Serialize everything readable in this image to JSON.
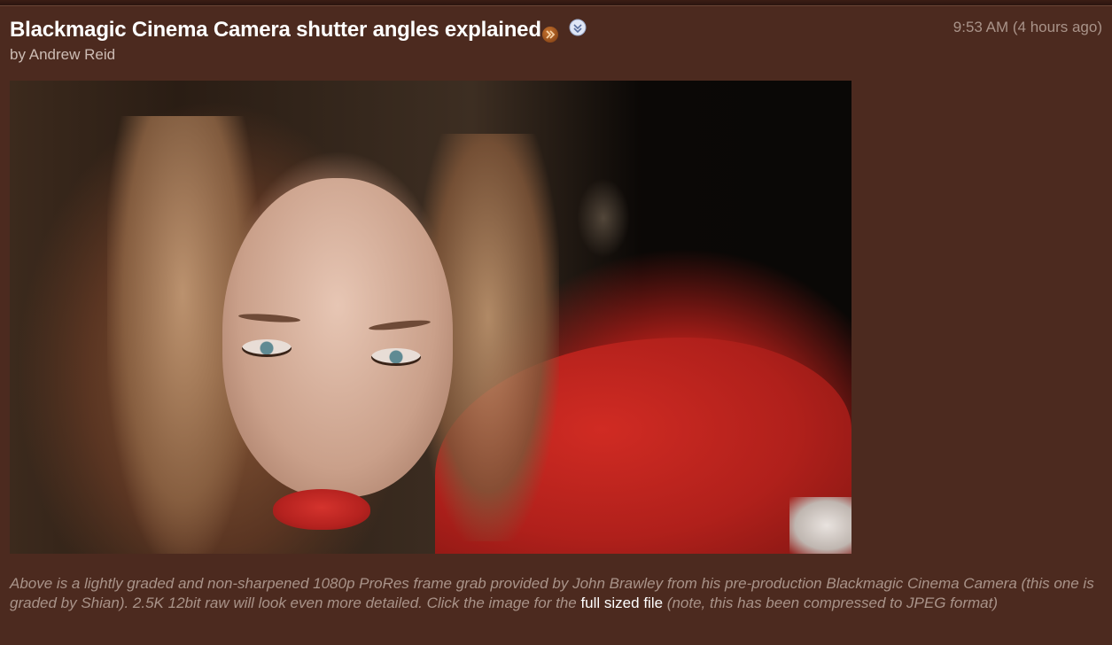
{
  "article": {
    "title": "Blackmagic Cinema Camera shutter angles explained",
    "byline": "by Andrew Reid",
    "timestamp": "9:53 AM (4 hours ago)",
    "icons": {
      "more": "double-chevron-right-icon",
      "expand": "expand-circle-icon"
    },
    "image": {
      "description_label": "portrait-frame-grab",
      "subject": "woman with blonde hair wearing red hood"
    },
    "caption": {
      "text_before_link": "Above is a lightly graded and non-sharpened 1080p ProRes frame grab provided by John Brawley from his pre-production Blackmagic Cinema Camera (this one is graded by Shian). 2.5K 12bit raw will look even more detailed. Click the image for the ",
      "link_text": "full sized file",
      "text_after_link": " (note, this has been compressed to JPEG format)"
    }
  },
  "colors": {
    "background": "#4c2a1f",
    "title": "#ffffff",
    "meta": "#a99389",
    "link": "#ffffff",
    "accent_orange": "#c8732e"
  }
}
